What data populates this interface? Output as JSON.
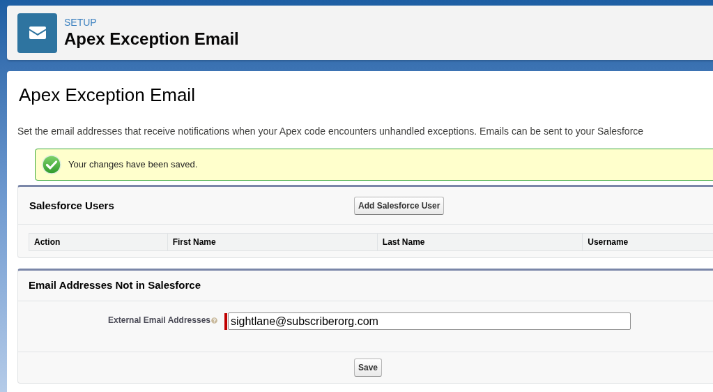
{
  "header": {
    "breadcrumb": "SETUP",
    "title": "Apex Exception Email"
  },
  "page": {
    "heading": "Apex Exception Email",
    "description": "Set the email addresses that receive notifications when your Apex code encounters unhandled exceptions. Emails can be sent to your Salesforce"
  },
  "message": {
    "kind": "success",
    "text": "Your changes have been saved."
  },
  "sections": [
    {
      "kind": "users",
      "title": "Salesforce Users",
      "button": "Add Salesforce User",
      "columns": [
        "Action",
        "First Name",
        "Last Name",
        "Username"
      ]
    },
    {
      "kind": "emails",
      "title": "Email Addresses Not in Salesforce",
      "fields": [
        {
          "label": "External Email Addresses",
          "value": "sightlane@subscriberorg.com",
          "required": true,
          "help": true
        }
      ],
      "button": "Save"
    }
  ]
}
